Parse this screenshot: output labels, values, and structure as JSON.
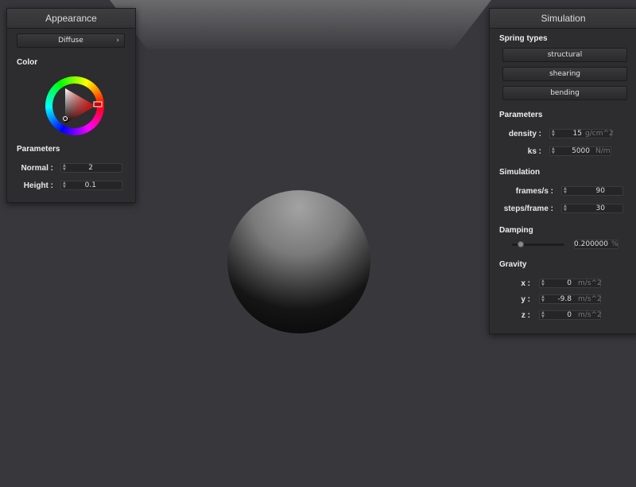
{
  "appearance": {
    "title": "Appearance",
    "material_label": "Diffuse",
    "color_label": "Color",
    "parameters_label": "Parameters",
    "normal_label": "Normal :",
    "normal_value": "2",
    "height_label": "Height :",
    "height_value": "0.1",
    "selected_color": "#a01818"
  },
  "simulation": {
    "title": "Simulation",
    "spring_types_label": "Spring types",
    "spring_buttons": [
      "structural",
      "shearing",
      "bending"
    ],
    "parameters_label": "Parameters",
    "density_label": "density :",
    "density_value": "15",
    "density_unit": "g/cm^2",
    "ks_label": "ks :",
    "ks_value": "5000",
    "ks_unit": "N/m",
    "simulation_label": "Simulation",
    "fps_label": "frames/s :",
    "fps_value": "90",
    "steps_label": "steps/frame :",
    "steps_value": "30",
    "damping_label": "Damping",
    "damping_value": "0.200000",
    "damping_unit": "%",
    "damping_fraction": 0.2,
    "gravity_label": "Gravity",
    "gx_label": "x :",
    "gx_value": "0",
    "gy_label": "y :",
    "gy_value": "-9.8",
    "gz_label": "z :",
    "gz_value": "0",
    "gravity_unit": "m/s^2"
  }
}
